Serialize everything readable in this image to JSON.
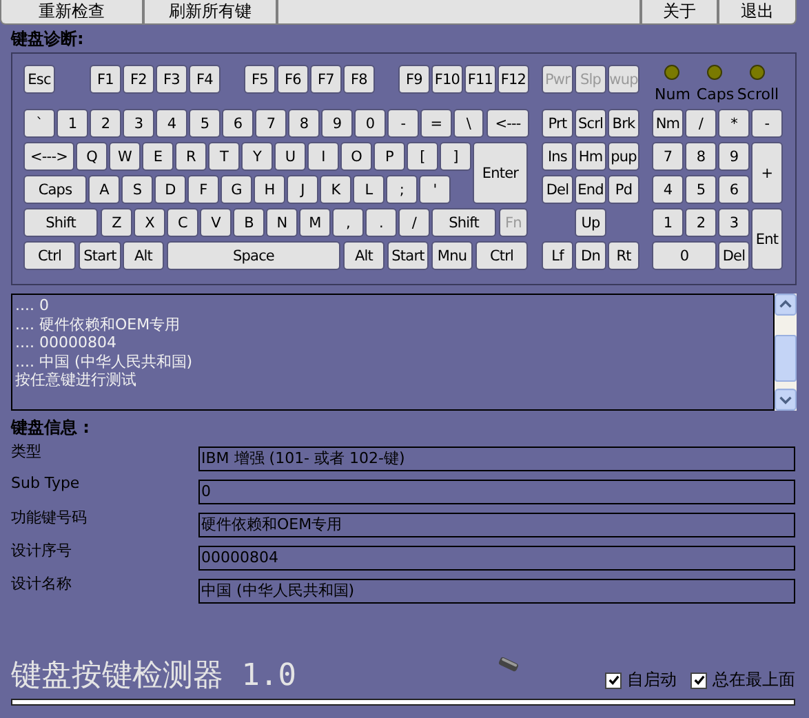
{
  "toolbar": [
    {
      "label": "重新检查"
    },
    {
      "label": "刷新所有键"
    },
    {
      "kind": "blank"
    },
    {
      "label": "关于"
    },
    {
      "label": "退出"
    }
  ],
  "diagnosis_title": "键盘诊断:",
  "function_keys": [
    {
      "label": "Esc",
      "disabled": false
    },
    {
      "label": "F1",
      "disabled": false
    },
    {
      "label": "F2",
      "disabled": false
    },
    {
      "label": "F3",
      "disabled": false
    },
    {
      "label": "F4",
      "disabled": false
    },
    {
      "label": "F5",
      "disabled": false
    },
    {
      "label": "F6",
      "disabled": false
    },
    {
      "label": "F7",
      "disabled": false
    },
    {
      "label": "F8",
      "disabled": false
    },
    {
      "label": "F9",
      "disabled": false
    },
    {
      "label": "F10",
      "disabled": false
    },
    {
      "label": "F11",
      "disabled": false
    },
    {
      "label": "F12",
      "disabled": false
    },
    {
      "label": "Pwr",
      "disabled": true
    },
    {
      "label": "Slp",
      "disabled": true
    },
    {
      "label": "wup",
      "disabled": true
    }
  ],
  "indicators": [
    {
      "label": "Num",
      "on": false
    },
    {
      "label": "Caps",
      "on": false
    },
    {
      "label": "Scroll",
      "on": false
    }
  ],
  "main_keys": [
    [
      {
        "label": "`",
        "disabled": false
      },
      {
        "label": "1",
        "disabled": false
      },
      {
        "label": "2",
        "disabled": false
      },
      {
        "label": "3",
        "disabled": false
      },
      {
        "label": "4",
        "disabled": false
      },
      {
        "label": "5",
        "disabled": false
      },
      {
        "label": "6",
        "disabled": false
      },
      {
        "label": "7",
        "disabled": false
      },
      {
        "label": "8",
        "disabled": false
      },
      {
        "label": "9",
        "disabled": false
      },
      {
        "label": "0",
        "disabled": false
      },
      {
        "label": "-",
        "disabled": false
      },
      {
        "label": "=",
        "disabled": false
      },
      {
        "label": "\\",
        "disabled": false
      },
      {
        "label": "<---",
        "disabled": false
      }
    ],
    [
      {
        "label": "<--->",
        "disabled": false
      },
      {
        "label": "Q",
        "disabled": false
      },
      {
        "label": "W",
        "disabled": false
      },
      {
        "label": "E",
        "disabled": false
      },
      {
        "label": "R",
        "disabled": false
      },
      {
        "label": "T",
        "disabled": false
      },
      {
        "label": "Y",
        "disabled": false
      },
      {
        "label": "U",
        "disabled": false
      },
      {
        "label": "I",
        "disabled": false
      },
      {
        "label": "O",
        "disabled": false
      },
      {
        "label": "P",
        "disabled": false
      },
      {
        "label": "[",
        "disabled": false
      },
      {
        "label": "]",
        "disabled": false
      },
      {
        "label": "Enter",
        "disabled": false
      }
    ],
    [
      {
        "label": "Caps",
        "disabled": false
      },
      {
        "label": "A",
        "disabled": false
      },
      {
        "label": "S",
        "disabled": false
      },
      {
        "label": "D",
        "disabled": false
      },
      {
        "label": "F",
        "disabled": false
      },
      {
        "label": "G",
        "disabled": false
      },
      {
        "label": "H",
        "disabled": false
      },
      {
        "label": "J",
        "disabled": false
      },
      {
        "label": "K",
        "disabled": false
      },
      {
        "label": "L",
        "disabled": false
      },
      {
        "label": ";",
        "disabled": false
      },
      {
        "label": "'",
        "disabled": false
      }
    ],
    [
      {
        "label": "Shift",
        "disabled": false
      },
      {
        "label": "Z",
        "disabled": false
      },
      {
        "label": "X",
        "disabled": false
      },
      {
        "label": "C",
        "disabled": false
      },
      {
        "label": "V",
        "disabled": false
      },
      {
        "label": "B",
        "disabled": false
      },
      {
        "label": "N",
        "disabled": false
      },
      {
        "label": "M",
        "disabled": false
      },
      {
        "label": ",",
        "disabled": false
      },
      {
        "label": ".",
        "disabled": false
      },
      {
        "label": "/",
        "disabled": false
      },
      {
        "label": "Shift",
        "disabled": false
      },
      {
        "label": "Fn",
        "disabled": true
      }
    ],
    [
      {
        "label": "Ctrl",
        "disabled": false
      },
      {
        "label": "Start",
        "disabled": false
      },
      {
        "label": "Alt",
        "disabled": false
      },
      {
        "label": "Space",
        "disabled": false
      },
      {
        "label": "Alt",
        "disabled": false
      },
      {
        "label": "Start",
        "disabled": false
      },
      {
        "label": "Mnu",
        "disabled": false
      },
      {
        "label": "Ctrl",
        "disabled": false
      }
    ]
  ],
  "nav_keys": [
    {
      "label": "Prt",
      "disabled": false
    },
    {
      "label": "Scrl",
      "disabled": false
    },
    {
      "label": "Brk",
      "disabled": false
    },
    {
      "label": "Ins",
      "disabled": false
    },
    {
      "label": "Hm",
      "disabled": false
    },
    {
      "label": "pup",
      "disabled": false
    },
    {
      "label": "Del",
      "disabled": false
    },
    {
      "label": "End",
      "disabled": false
    },
    {
      "label": "Pd",
      "disabled": false
    },
    {
      "label": "Up",
      "disabled": false
    },
    {
      "label": "Lf",
      "disabled": false
    },
    {
      "label": "Dn",
      "disabled": false
    },
    {
      "label": "Rt",
      "disabled": false
    }
  ],
  "numpad_keys": [
    {
      "label": "Nm",
      "disabled": false
    },
    {
      "label": "/",
      "disabled": false
    },
    {
      "label": "*",
      "disabled": false
    },
    {
      "label": "-",
      "disabled": false
    },
    {
      "label": "7",
      "disabled": false
    },
    {
      "label": "8",
      "disabled": false
    },
    {
      "label": "9",
      "disabled": false
    },
    {
      "label": "+",
      "disabled": false
    },
    {
      "label": "4",
      "disabled": false
    },
    {
      "label": "5",
      "disabled": false
    },
    {
      "label": "6",
      "disabled": false
    },
    {
      "label": "1",
      "disabled": false
    },
    {
      "label": "2",
      "disabled": false
    },
    {
      "label": "3",
      "disabled": false
    },
    {
      "label": "Ent",
      "disabled": false
    },
    {
      "label": "0",
      "disabled": false
    },
    {
      "label": "Del",
      "disabled": false
    }
  ],
  "log_lines": [
    ".... 0",
    ".... 硬件依赖和OEM专用",
    ".... 00000804",
    ".... 中国 (中华人民共和国)",
    "按任意键进行测试"
  ],
  "info_title": "键盘信息 :",
  "info_rows": [
    {
      "label": "类型",
      "value": "IBM 增强 (101- 或者 102-键)"
    },
    {
      "label": "Sub Type",
      "value": "0"
    },
    {
      "label": "功能键号码",
      "value": "硬件依赖和OEM专用"
    },
    {
      "label": "设计序号",
      "value": "00000804"
    },
    {
      "label": "设计名称",
      "value": "中国 (中华人民共和国)"
    }
  ],
  "app_title": "键盘按键检测器 1.0",
  "options": [
    {
      "label": "自启动",
      "checked": true
    },
    {
      "label": "总在最上面",
      "checked": true
    }
  ]
}
